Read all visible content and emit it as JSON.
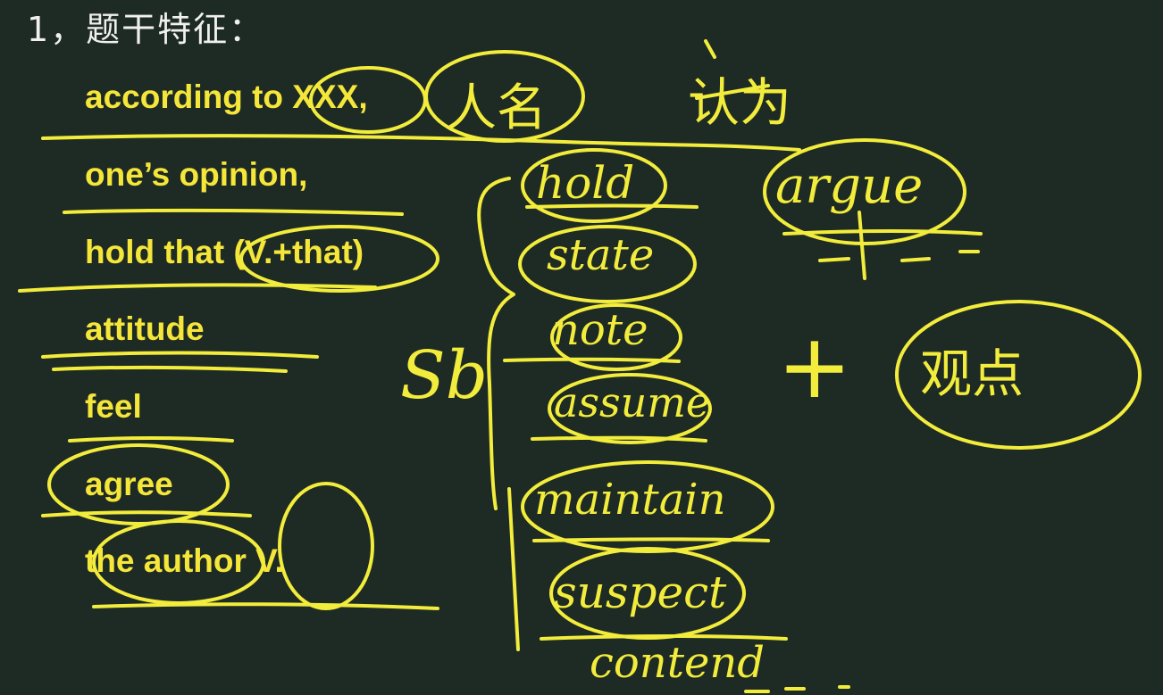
{
  "slide": {
    "heading": "1，题干特征：",
    "terms": [
      "according to XXX,",
      "one’s opinion,",
      "hold that (V.+that)",
      "attitude",
      "feel",
      "agree",
      "the author V."
    ]
  },
  "annotations": {
    "person_note": "人名",
    "think_note": "认为",
    "sb": "Sb",
    "verbs": [
      "hold",
      "state",
      "note",
      "assume",
      "maintain",
      "suspect",
      "contend"
    ],
    "argue": "argue",
    "plus": "+",
    "viewpoint_note": "观点"
  },
  "colors": {
    "background": "#1e2a24",
    "slide_text": "#f5e63a",
    "ink": "#f2ec3c",
    "heading": "#f0f0f0"
  }
}
